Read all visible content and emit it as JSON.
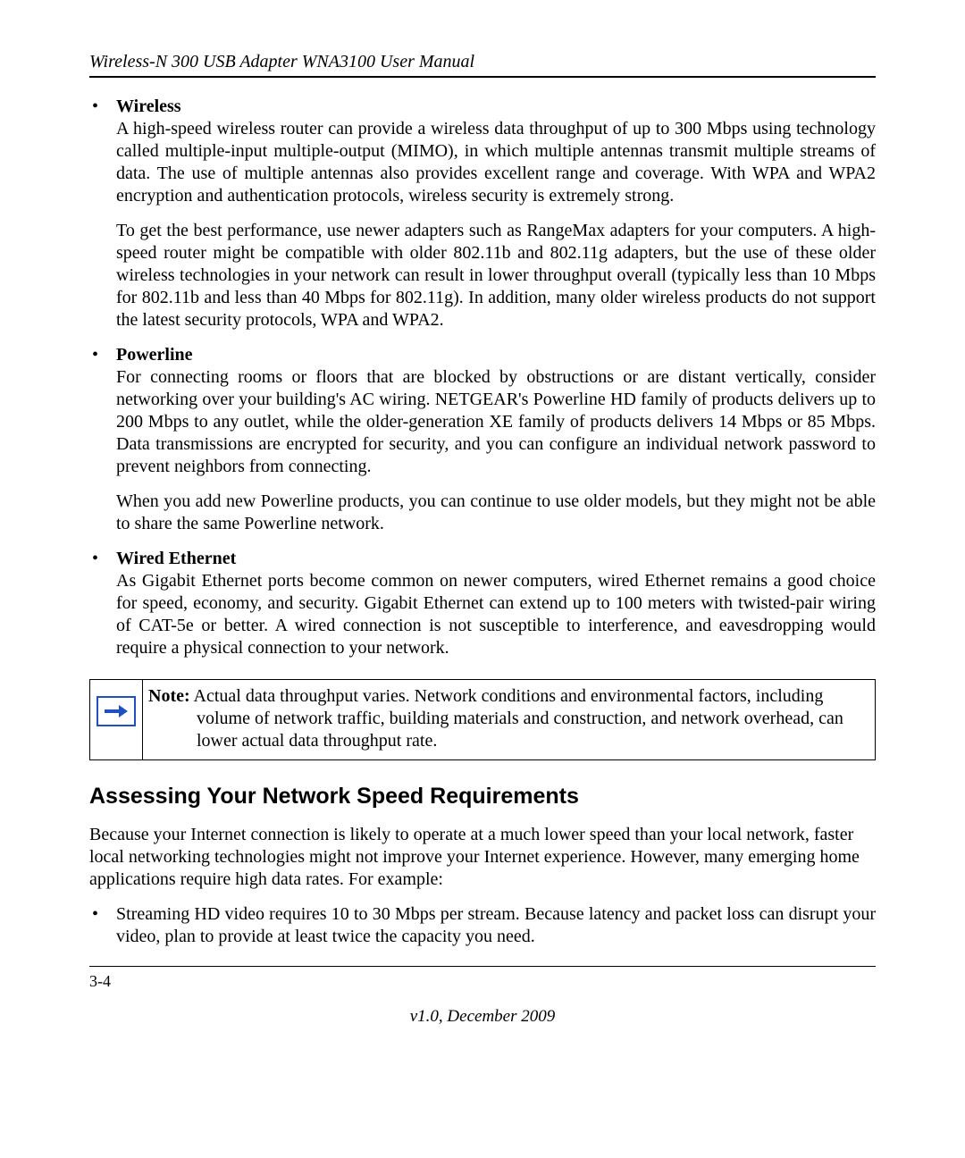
{
  "header": {
    "title": "Wireless-N 300 USB Adapter WNA3100 User Manual"
  },
  "bullets": {
    "wireless": {
      "heading": "Wireless",
      "p1": "A high-speed wireless router can provide a wireless data throughput of up to 300 Mbps using technology called multiple-input multiple-output (MIMO), in which multiple antennas transmit multiple streams of data. The use of multiple antennas also provides excellent range and coverage. With WPA and WPA2 encryption and authentication protocols, wireless security is extremely strong.",
      "p2": "To get the best performance, use newer adapters such as RangeMax adapters for your computers. A high-speed router might be compatible with older 802.11b and 802.11g adapters, but the use of these older wireless technologies in your network can result in lower throughput overall (typically less than 10 Mbps for 802.11b and less than 40 Mbps for 802.11g). In addition, many older wireless products do not support the latest security protocols, WPA and WPA2."
    },
    "powerline": {
      "heading": "Powerline",
      "p1": "For connecting rooms or floors that are blocked by obstructions or are distant vertically, consider networking over your building's AC wiring. NETGEAR's Powerline HD family of products delivers up to 200 Mbps to any outlet, while the older-generation XE family of products delivers 14 Mbps or 85 Mbps. Data transmissions are encrypted for security, and you can configure an individual network password to prevent neighbors from connecting.",
      "p2": "When you add new Powerline products, you can continue to use older models, but they might not be able to share the same Powerline network."
    },
    "wired": {
      "heading": "Wired Ethernet",
      "p1": "As Gigabit Ethernet ports become common on newer computers, wired Ethernet remains a good choice for speed, economy, and security. Gigabit Ethernet can extend up to 100 meters with twisted-pair wiring of CAT-5e or better. A wired connection is not susceptible to interference, and eavesdropping would require a physical connection to your network."
    }
  },
  "note": {
    "label": "Note:",
    "text": " Actual data throughput varies. Network conditions and environmental factors, including volume of network traffic, building materials and construction, and network overhead, can lower actual data throughput rate."
  },
  "section": {
    "heading": "Assessing Your Network Speed Requirements",
    "intro": "Because your Internet connection is likely to operate at a much lower speed than your local network, faster local networking technologies might not improve your Internet experience. However, many emerging home applications require high data rates. For example:",
    "sub1": "Streaming HD video requires 10 to 30 Mbps per stream. Because latency and packet loss can disrupt your video, plan to provide at least twice the capacity you need."
  },
  "footer": {
    "pagenum": "3-4",
    "version": "v1.0, December 2009"
  }
}
